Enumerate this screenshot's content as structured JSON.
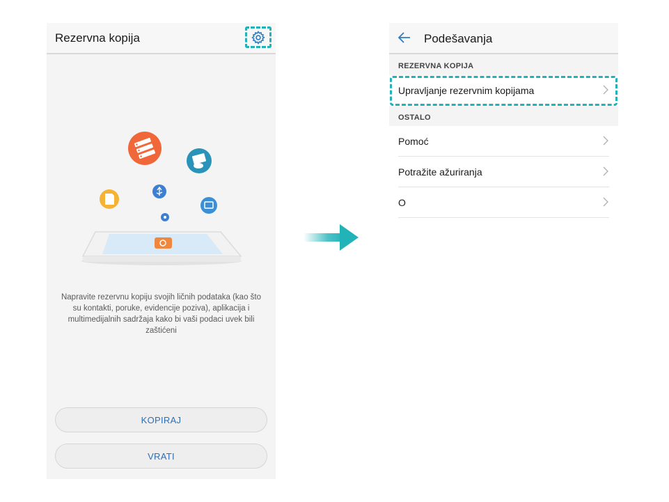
{
  "left_screen": {
    "title": "Rezervna kopija",
    "settings_icon": "gear-icon",
    "description": "Napravite rezervnu kopiju svojih ličnih podataka (kao što su kontakti, poruke, evidencije poziva), aplikacija i multimedijalnih sadržaja kako bi vaši podaci uvek bili zaštićeni",
    "buttons": {
      "backup_label": "KOPIRAJ",
      "restore_label": "VRATI"
    }
  },
  "right_screen": {
    "title": "Podešavanja",
    "back_icon": "back-arrow-icon",
    "sections": [
      {
        "label": "REZERVNA KOPIJA",
        "items": [
          {
            "label": "Upravljanje rezervnim kopijama"
          }
        ]
      },
      {
        "label": "OSTALO",
        "items": [
          {
            "label": "Pomoć"
          },
          {
            "label": "Potražite ažuriranja"
          },
          {
            "label": "O"
          }
        ]
      }
    ]
  },
  "colors": {
    "highlight": "#22b3b9",
    "button_text": "#2e6fb4"
  }
}
